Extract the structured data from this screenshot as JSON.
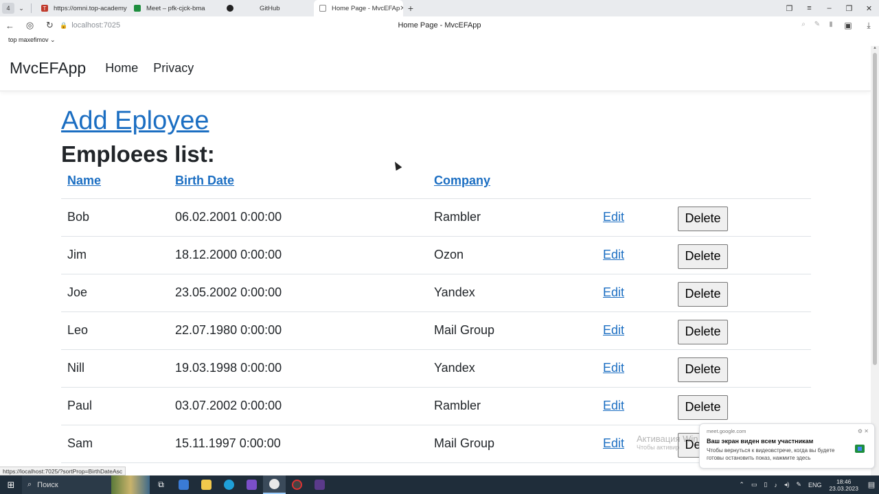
{
  "browser": {
    "tab_count": "4",
    "tabs": [
      {
        "label": "https://omni.top-academy",
        "icon": "top-academy-icon",
        "color": "#c0392b"
      },
      {
        "label": "Meet – pfk-cjck-bma",
        "icon": "google-meet-icon",
        "color": "#1e8e3e"
      },
      {
        "label": "GitHub",
        "icon": "github-icon",
        "color": "#222222"
      },
      {
        "label": "Home Page - MvcEFAp",
        "icon": "page-icon",
        "color": "#888888"
      }
    ],
    "url": "localhost:7025",
    "page_title": "Home Page - MvcEFApp",
    "bookmark_folder": "top maxefimov",
    "status_url": "https://localhost:7025/?sortProp=BirthDateAsc"
  },
  "app": {
    "brand": "MvcEFApp",
    "nav": [
      "Home",
      "Privacy"
    ],
    "add_link": "Add Eployee",
    "list_title": "Emploees list:",
    "columns": {
      "name": "Name",
      "birth": "Birth Date",
      "company": "Company"
    },
    "edit_label": "Edit",
    "delete_label": "Delete",
    "link_color": "#1b6ec2",
    "rows": [
      {
        "name": "Bob",
        "birth": "06.02.2001 0:00:00",
        "company": "Rambler"
      },
      {
        "name": "Jim",
        "birth": "18.12.2000 0:00:00",
        "company": "Ozon"
      },
      {
        "name": "Joe",
        "birth": "23.05.2002 0:00:00",
        "company": "Yandex"
      },
      {
        "name": "Leo",
        "birth": "22.07.1980 0:00:00",
        "company": "Mail Group"
      },
      {
        "name": "Nill",
        "birth": "19.03.1998 0:00:00",
        "company": "Yandex"
      },
      {
        "name": "Paul",
        "birth": "03.07.2002 0:00:00",
        "company": "Rambler"
      },
      {
        "name": "Sam",
        "birth": "15.11.1997 0:00:00",
        "company": "Mail Group"
      }
    ]
  },
  "overlay": {
    "activation": "Активация Win",
    "activation_sub": "Чтобы активир",
    "toast": {
      "source": "meet.google.com",
      "title": "Ваш экран виден всем участникам",
      "text": "Чтобы вернуться к видеовстрече, когда вы будете готовы остановить показ, нажмите здесь"
    }
  },
  "taskbar": {
    "search": "Поиск",
    "lang": "ENG",
    "time": "18:46",
    "date": "23.03.2023"
  }
}
